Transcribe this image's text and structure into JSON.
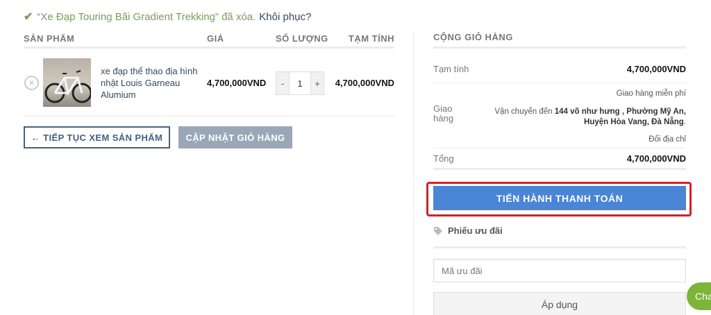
{
  "notice": {
    "message": "“Xe Đạp Touring Bãi Gradient Trekking” đã xóa.",
    "restore_link": "Khôi phục?",
    "icon": "check-icon"
  },
  "cart": {
    "columns": {
      "product": "SẢN PHẨM",
      "price": "GIÁ",
      "quantity": "SỐ LƯỢNG",
      "subtotal": "TẠM TÍNH"
    },
    "item": {
      "remove_symbol": "×",
      "name": "xe đạp thể thao địa hình nhật Louis Garneau Alumium",
      "price": "4,700,000VND",
      "qty_minus": "-",
      "quantity": "1",
      "qty_plus": "+",
      "subtotal": "4,700,000VND"
    },
    "continue_button": "← TIẾP TỤC XEM SẢN PHẨM",
    "update_button": "CẬP NHẬT GIỎ HÀNG"
  },
  "totals": {
    "title": "CỘNG GIỎ HÀNG",
    "subtotal_label": "Tạm tính",
    "subtotal_value": "4,700,000VND",
    "shipping_free": "Giao hàng miễn phí",
    "shipping_label": "Giao hàng",
    "shipping_dest_prefix": "Vận chuyển đến ",
    "shipping_dest_address": "144 võ như hưng , Phường Mỹ An, Huyện Hòa Vang, Đà Nẵng",
    "shipping_dest_suffix": ".",
    "change_address": "Đổi địa chỉ",
    "total_label": "Tổng",
    "total_value": "4,700,000VND",
    "checkout_button": "TIẾN HÀNH THANH TOÁN"
  },
  "coupon": {
    "title": "Phiếu ưu đãi",
    "icon": "tag-icon",
    "placeholder": "Mã ưu đãi",
    "apply_button": "Áp dụng"
  },
  "chat": {
    "label": "Cha"
  },
  "colors": {
    "accent": "#446084",
    "checkout": "#4a85d6",
    "success": "#7a9c59",
    "highlight": "#d42027",
    "chat": "#7db43a"
  }
}
